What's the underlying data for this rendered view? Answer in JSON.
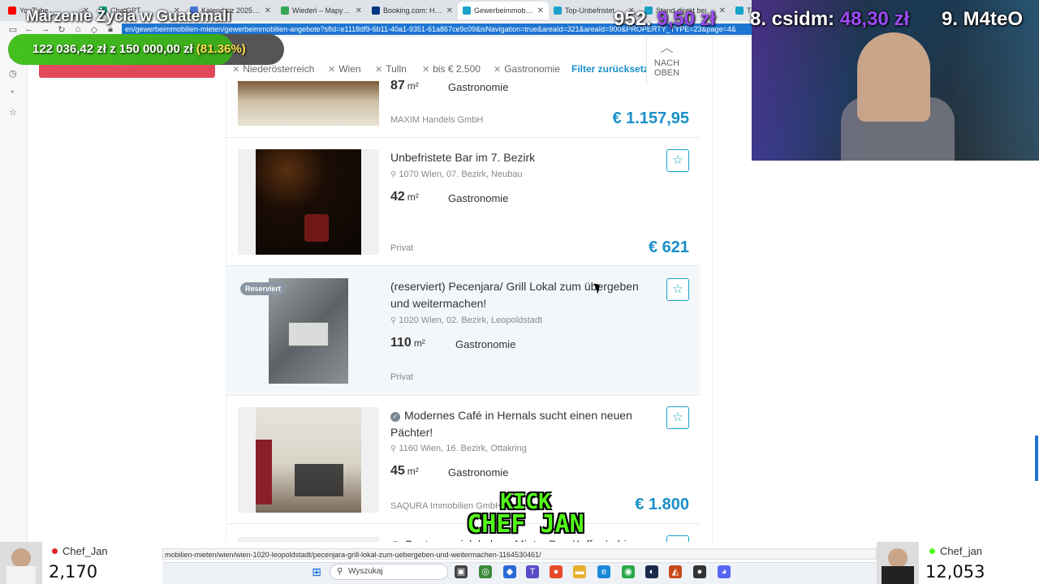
{
  "browser": {
    "tabs": [
      {
        "label": "YouTube",
        "color": "#ff0000",
        "active": false
      },
      {
        "label": "ChatGPT",
        "color": "#10a37f",
        "active": false
      },
      {
        "label": "Kalendarz 2025 - z",
        "color": "#4a77d4",
        "active": false
      },
      {
        "label": "Wiedeń – Mapy Goo",
        "color": "#34a853",
        "active": false
      },
      {
        "label": "Booking.com: Hotel",
        "color": "#003580",
        "active": false
      },
      {
        "label": "Gewerbeimmobilien",
        "color": "#1aa3c9",
        "active": true
      },
      {
        "label": "Top-Unbefristeter-In",
        "color": "#1aa3c9",
        "active": false
      },
      {
        "label": "Stand direkt bei Ub",
        "color": "#1aa3c9",
        "active": false
      },
      {
        "label": "Tra",
        "color": "#1aa3c9",
        "active": false
      }
    ],
    "url": "en/gewerbeimmobilien-mieten/gewerbeimmobilien-angebote?sfId=e1118df9-6b11-40a1-9351-61a867ce9c09&isNavigation=true&areaId=321&areaId=900&PROPERTY_TYPE=23&page=4&",
    "status_url": "mobilien-mieten/wien/wien-1020-leopoldstadt/pecenjara-grill-lokal-zum-uebergeben-und-weitermachen-1164530461/"
  },
  "filters": {
    "partial_label": "igen",
    "chips": [
      "Niederösterreich",
      "Wien",
      "Tulln",
      "bis € 2.500",
      "Gastronomie"
    ],
    "reset_label": "Filter zurücksetzen",
    "back_to_top": "NACH OBEN"
  },
  "listings": [
    {
      "title": "",
      "location": "",
      "area": "87",
      "unit": "m²",
      "category": "Gastronomie",
      "seller": "MAXIM Handels GmbH",
      "price": "€ 1.157,95",
      "badge": ""
    },
    {
      "title": "Unbefristete Bar im 7. Bezirk",
      "location": "1070 Wien, 07. Bezirk, Neubau",
      "area": "42",
      "unit": "m²",
      "category": "Gastronomie",
      "seller": "Privat",
      "price": "€ 621",
      "badge": ""
    },
    {
      "title": "(reserviert) Pecenjara/ Grill Lokal zum übergeben und weitermachen!",
      "location": "1020 Wien, 02. Bezirk, Leopoldstadt",
      "area": "110",
      "unit": "m²",
      "category": "Gastronomie",
      "seller": "Privat",
      "price": "",
      "badge": "Reserviert"
    },
    {
      "title": "Modernes Café in Hernals sucht einen neuen Pächter!",
      "location": "1160 Wien, 16. Bezirk, Ottakring",
      "area": "45",
      "unit": "m²",
      "category": "Gastronomie",
      "seller": "SAQURA Immobilien GmbH",
      "price": "€ 1.800",
      "badge": ""
    },
    {
      "title": "Gastronomielokal zur Miete: Bar, Kaffe, Imbiss,",
      "location": "",
      "area": "",
      "unit": "",
      "category": "",
      "seller": "",
      "price": "",
      "badge": ""
    }
  ],
  "stream": {
    "title": "Marzenie Życia w Guatemali",
    "goal_current": "122 036,42 zł",
    "goal_sep": "z",
    "goal_target": "150 000,00 zł",
    "goal_pct_label": "(81.36%)",
    "goal_fraction": 0.8136,
    "rank_7_prefix": "952.",
    "rank_7_amount": "9,50 zł",
    "rank_8_prefix": "8. csidm:",
    "rank_8_amount": "48,30 zł",
    "rank_9": "9. M4teO",
    "kick_line1": "KICK",
    "kick_line2": "CHEF JAN",
    "left_viewer_name": "Chef_Jan",
    "left_viewer_count": "2,170",
    "right_viewer_name": "Chef_jan",
    "right_viewer_count": "12,053"
  },
  "taskbar": {
    "search_placeholder": "Wyszukaj"
  },
  "colors": {
    "accent": "#1a8fc9",
    "star": "#1aa3c9",
    "kick_green": "#53fc18",
    "donation_purple": "#9b4bf5"
  }
}
